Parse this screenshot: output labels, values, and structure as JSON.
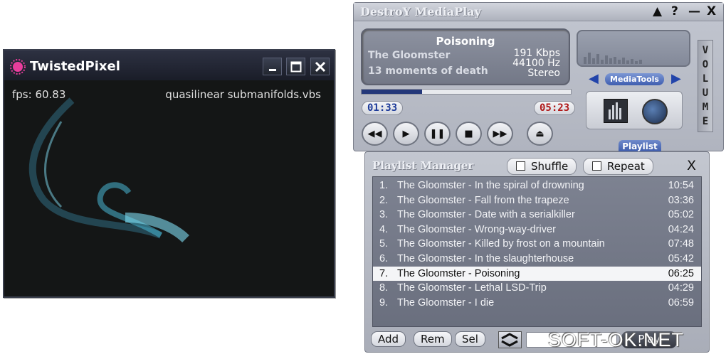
{
  "twistedpixel": {
    "title": "TwistedPixel",
    "fps_text": "fps: 60.83",
    "filename": "quasilinear submanifolds.vbs",
    "colors": {
      "background": "#141616",
      "titlebar": "#222633",
      "logo": "#e83d9c",
      "swirl": "#49b8d6"
    }
  },
  "mediaplayer": {
    "title": "DestroY MediaPlay",
    "song": "Poisoning",
    "artist": "The Gloomster",
    "album": "13 moments of death",
    "bitrate": "191 Kbps",
    "frequency": "44100 Hz",
    "mode": "Stereo",
    "volume_label": "VOLUME",
    "mediatools_label": "MediaTools",
    "elapsed": "01:33",
    "total": "05:23",
    "progress_fraction": 0.29,
    "playlist_tab": "Playlist",
    "colors": {
      "accent": "#2244aa",
      "time_elapsed": "#1c3a99",
      "time_total": "#b01818",
      "progress": "#24387a"
    }
  },
  "playlist": {
    "title": "Playlist Manager",
    "shuffle_label": "Shuffle",
    "repeat_label": "Repeat",
    "close_label": "X",
    "active_index": 6,
    "tracks": [
      {
        "num": "1.",
        "name": "The Gloomster - In the spiral of drowning",
        "duration": "10:54"
      },
      {
        "num": "2.",
        "name": "The Gloomster - Fall from the trapeze",
        "duration": "03:36"
      },
      {
        "num": "3.",
        "name": "The Gloomster - Date with a serialkiller",
        "duration": "05:02"
      },
      {
        "num": "4.",
        "name": "The Gloomster - Wrong-way-driver",
        "duration": "04:24"
      },
      {
        "num": "5.",
        "name": "The Gloomster - Killed by frost on a mountain",
        "duration": "07:48"
      },
      {
        "num": "6.",
        "name": "The Gloomster - In the slaughterhouse",
        "duration": "05:42"
      },
      {
        "num": "7.",
        "name": "The Gloomster - Poisoning",
        "duration": "06:25"
      },
      {
        "num": "8.",
        "name": "The Gloomster - Lethal LSD-Trip",
        "duration": "04:29"
      },
      {
        "num": "9.",
        "name": "The Gloomster - I die",
        "duration": "06:59"
      }
    ],
    "buttons": {
      "add": "Add",
      "rem": "Rem",
      "sel": "Sel",
      "play": "Play"
    }
  },
  "watermark": "SOFT-OK.NET",
  "icons": [
    "logo-icon",
    "minimize-icon",
    "maximize-icon",
    "close-icon",
    "rewind-icon",
    "play-icon",
    "pause-icon",
    "stop-icon",
    "fast-forward-icon",
    "eject-icon",
    "equalizer-icon",
    "knob-icon",
    "sort-icon"
  ]
}
